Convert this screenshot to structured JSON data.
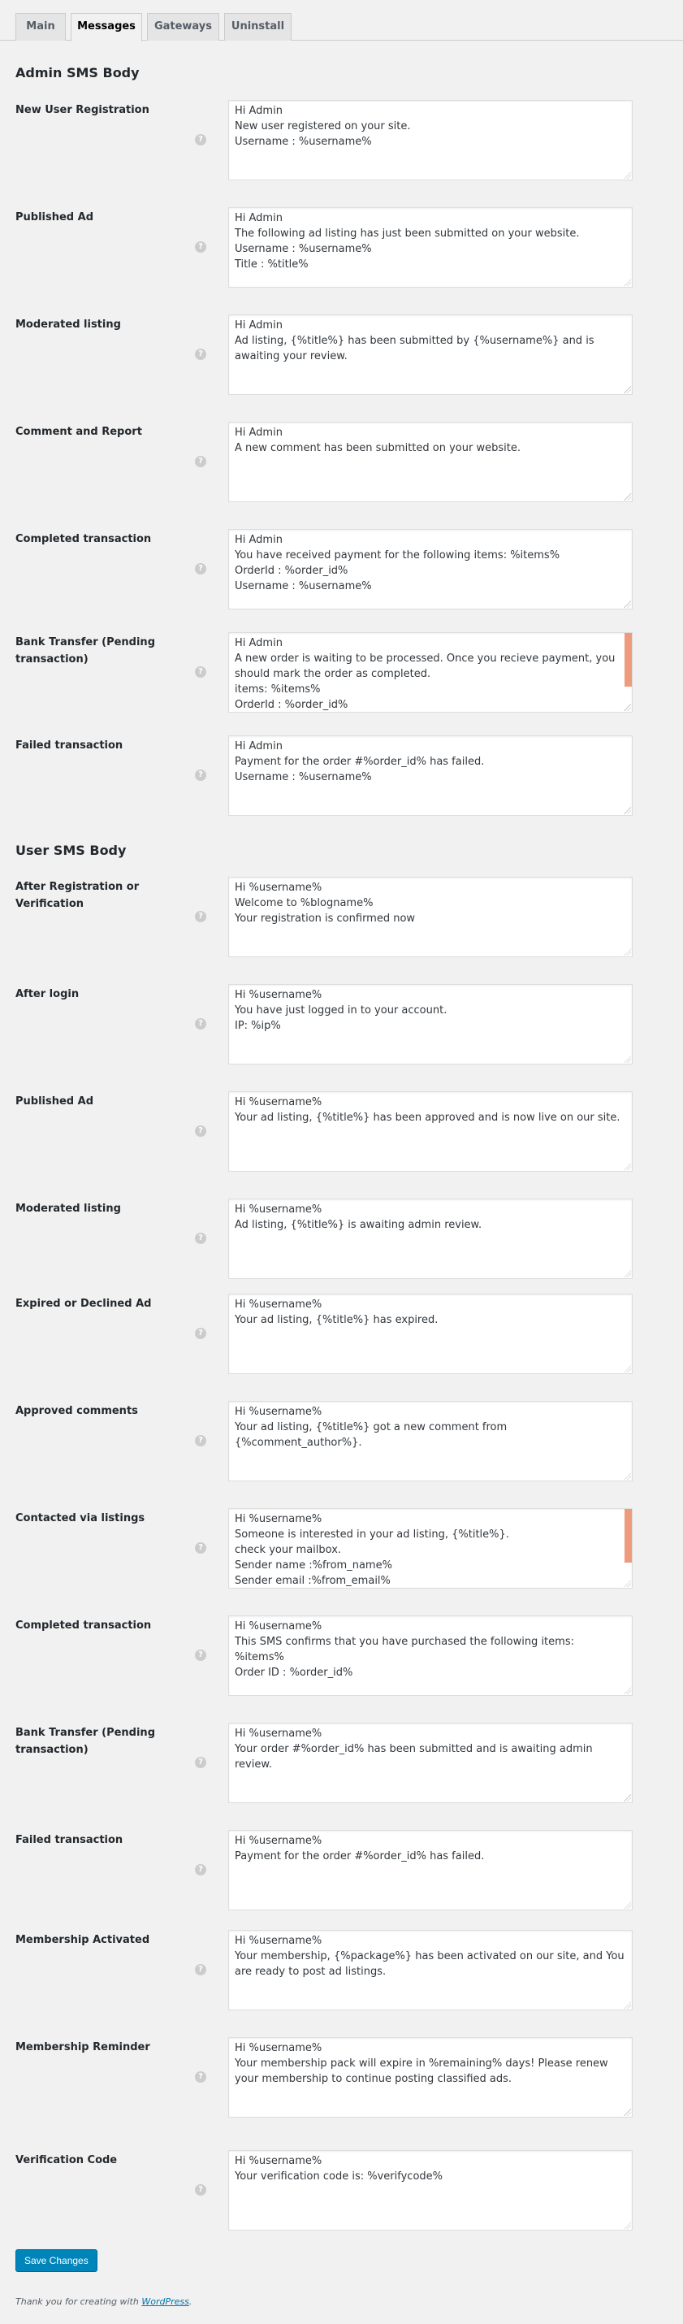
{
  "tabs": [
    {
      "label": "Main",
      "active": false
    },
    {
      "label": "Messages",
      "active": true
    },
    {
      "label": "Gateways",
      "active": false
    },
    {
      "label": "Uninstall",
      "active": false
    }
  ],
  "admin_section": {
    "title": "Admin SMS Body",
    "fields": [
      {
        "label": "New User Registration",
        "value": "Hi Admin\nNew user registered on your site.\nUsername : %username%"
      },
      {
        "label": "Published Ad",
        "value": "Hi Admin\nThe following ad listing has just been submitted on your website.\nUsername : %username%\nTitle : %title%"
      },
      {
        "label": "Moderated listing",
        "value": "Hi Admin\nAd listing, {%title%} has been submitted by {%username%} and is awaiting your review."
      },
      {
        "label": "Comment and Report",
        "value": "Hi Admin\nA new comment has been submitted on your website."
      },
      {
        "label": "Completed transaction",
        "value": "Hi Admin\nYou have received payment for the following items: %items%\nOrderId : %order_id%\nUsername : %username%"
      },
      {
        "label": "Bank Transfer (Pending transaction)",
        "value": "Hi Admin\nA new order is waiting to be processed. Once you recieve payment, you should mark the order as completed.\nitems: %items%\nOrderId : %order_id%",
        "scrollable": true
      },
      {
        "label": "Failed transaction",
        "value": "Hi Admin\nPayment for the order #%order_id% has failed.\nUsername : %username%"
      }
    ]
  },
  "user_section": {
    "title": "User SMS Body",
    "fields": [
      {
        "label": "After Registration or Verification",
        "value": "Hi %username%\nWelcome to %blogname%\nYour registration is confirmed now"
      },
      {
        "label": "After login",
        "value": "Hi %username%\nYou have just logged in to your account.\nIP: %ip%"
      },
      {
        "label": "Published Ad",
        "value": "Hi %username%\nYour ad listing, {%title%} has been approved and is now live on our site."
      },
      {
        "label": "Moderated listing",
        "value": "Hi %username%\nAd listing, {%title%} is awaiting admin review."
      },
      {
        "label": "Expired or Declined Ad",
        "value": "Hi %username%\nYour ad listing, {%title%} has expired."
      },
      {
        "label": "Approved comments",
        "value": "Hi %username%\nYour ad listing, {%title%} got a new comment from {%comment_author%}."
      },
      {
        "label": "Contacted via listings",
        "value": "Hi %username%\nSomeone is interested in your ad listing, {%title%}.\ncheck your mailbox.\nSender name :%from_name%\nSender email :%from_email%",
        "scrollable": true
      },
      {
        "label": "Completed transaction",
        "value": "Hi %username%\nThis SMS confirms that you have purchased the following items: %items%\nOrder ID : %order_id%"
      },
      {
        "label": "Bank Transfer (Pending transaction)",
        "value": "Hi %username%\nYour order #%order_id% has been submitted and is awaiting admin review."
      },
      {
        "label": "Failed transaction",
        "value": "Hi %username%\nPayment for the order #%order_id% has failed."
      },
      {
        "label": "Membership Activated",
        "value": "Hi %username%\nYour membership, {%package%} has been activated on our site, and You are ready to post ad listings."
      },
      {
        "label": "Membership Reminder",
        "value": "Hi %username%\nYour membership pack will expire in %remaining% days! Please renew your membership to continue posting classified ads."
      },
      {
        "label": "Verification Code",
        "value": "Hi %username%\nYour verification code is: %verifycode%"
      }
    ]
  },
  "help_icon": "question-circle-icon",
  "save_label": "Save Changes",
  "footer": {
    "prefix": "Thank you for creating with ",
    "link": "WordPress",
    "suffix": "."
  },
  "colors": {
    "accent": "#0085ba",
    "link": "#0073aa",
    "scrollbar": "#ee9a7c"
  }
}
